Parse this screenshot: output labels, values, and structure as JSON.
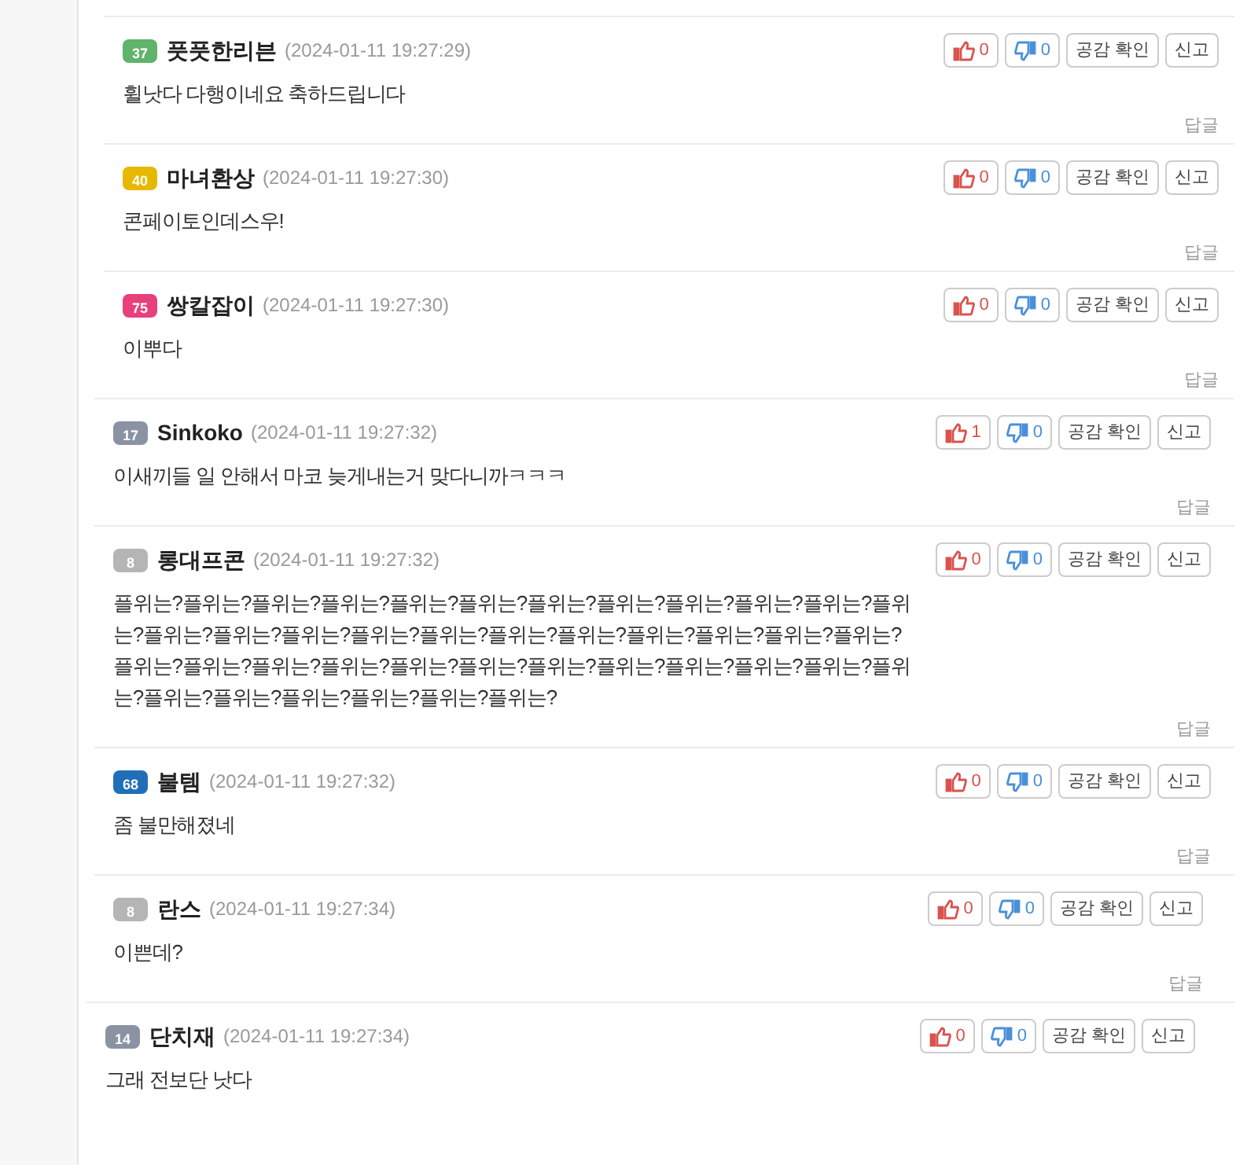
{
  "comments": [
    {
      "level": "37",
      "color": "#5fb36a",
      "name": "풋풋한리븐",
      "time": "(2024-01-11 19:27:29)",
      "body": "휠낫다 다행이네요 축하드립니다",
      "likes": "0",
      "dislikes": "0",
      "empathy": "공감 확인",
      "report": "신고",
      "reply": "답글"
    },
    {
      "level": "40",
      "color": "#e6b800",
      "name": "마녀환상",
      "time": "(2024-01-11 19:27:30)",
      "body": "콘페이토인데스우!",
      "likes": "0",
      "dislikes": "0",
      "empathy": "공감 확인",
      "report": "신고",
      "reply": "답글"
    },
    {
      "level": "75",
      "color": "#e8407a",
      "name": "쌍칼잡이",
      "time": "(2024-01-11 19:27:30)",
      "body": "이뿌다",
      "likes": "0",
      "dislikes": "0",
      "empathy": "공감 확인",
      "report": "신고",
      "reply": "답글"
    },
    {
      "level": "17",
      "color": "#8a93a3",
      "name": "Sinkoko",
      "time": "(2024-01-11 19:27:32)",
      "body": "이새끼들 일 안해서 마코 늦게내는거 맞다니까ㅋㅋㅋ",
      "likes": "1",
      "dislikes": "0",
      "empathy": "공감 확인",
      "report": "신고",
      "reply": "답글"
    },
    {
      "level": "8",
      "color": "#b5b5b5",
      "name": "롱대프콘",
      "time": "(2024-01-11 19:27:32)",
      "body": "플위는?플위는?플위는?플위는?플위는?플위는?플위는?플위는?플위는?플위는?플위는?플위는?플위는?플위는?플위는?플위는?플위는?플위는?플위는?플위는?플위는?플위는?플위는?플위는?플위는?플위는?플위는?플위는?플위는?플위는?플위는?플위는?플위는?플위는?플위는?플위는?플위는?플위는?플위는?플위는?플위는?",
      "likes": "0",
      "dislikes": "0",
      "empathy": "공감 확인",
      "report": "신고",
      "reply": "답글"
    },
    {
      "level": "68",
      "color": "#1f6fb8",
      "name": "불템",
      "time": "(2024-01-11 19:27:32)",
      "body": "좀 불만해졌네",
      "likes": "0",
      "dislikes": "0",
      "empathy": "공감 확인",
      "report": "신고",
      "reply": "답글"
    },
    {
      "level": "8",
      "color": "#b5b5b5",
      "name": "란스",
      "time": "(2024-01-11 19:27:34)",
      "body": "이쁜데?",
      "likes": "0",
      "dislikes": "0",
      "empathy": "공감 확인",
      "report": "신고",
      "reply": "답글"
    },
    {
      "level": "14",
      "color": "#8a93a3",
      "name": "단치재",
      "time": "(2024-01-11 19:27:34)",
      "body": "그래 전보단 낫다",
      "likes": "0",
      "dislikes": "0",
      "empathy": "공감 확인",
      "report": "신고"
    }
  ]
}
